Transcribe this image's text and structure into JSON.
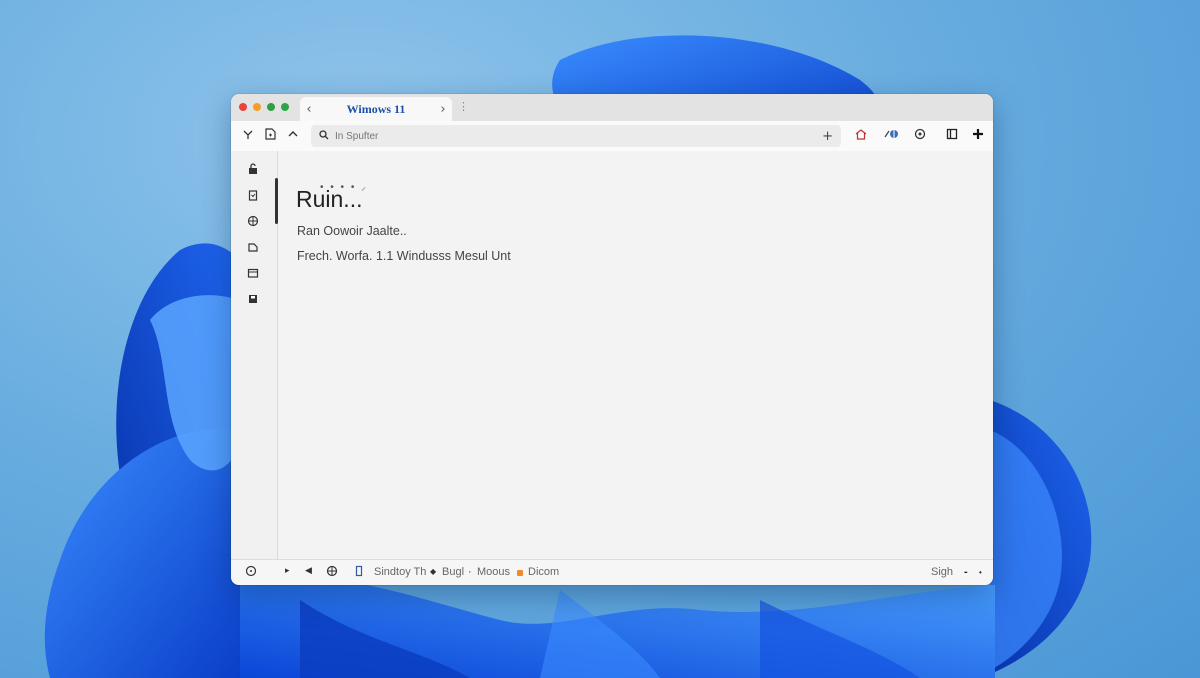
{
  "window": {
    "tab_title": "Wimows 11",
    "tab_back": "‹",
    "tab_forward": "›",
    "tab_menu": "⋮"
  },
  "toolbar": {
    "address_placeholder": "In Spufter",
    "new_tab": "+"
  },
  "content": {
    "loading_dots": "• • • •   ⸝",
    "heading": "Ruin...",
    "line1": "Ran Oowoir Jaalte..",
    "line2": "Frech. Worfa.  1.1 Windusss Mesul Unt"
  },
  "statusbar": {
    "label1": "Sindtoy Th",
    "label2": "Bugl",
    "label3": "Moous",
    "label4": "Dicom",
    "right_label": "Sigh",
    "right_dash": "-",
    "right_dot": "•"
  },
  "colors": {
    "close": "#e8443a",
    "minimize": "#f0a02a",
    "maximize": "#2ea043",
    "extra": "#27a844",
    "tab_title": "#1d4fa8",
    "status_accent": "#f08a2c"
  },
  "icons": {
    "sidebar": [
      "lock-icon",
      "trash-icon",
      "globe-icon",
      "document-icon",
      "folder-icon",
      "save-icon"
    ],
    "toolbar_right": [
      "home-icon",
      "extension-icon",
      "shield-icon",
      "window-icon",
      "star-icon"
    ]
  }
}
